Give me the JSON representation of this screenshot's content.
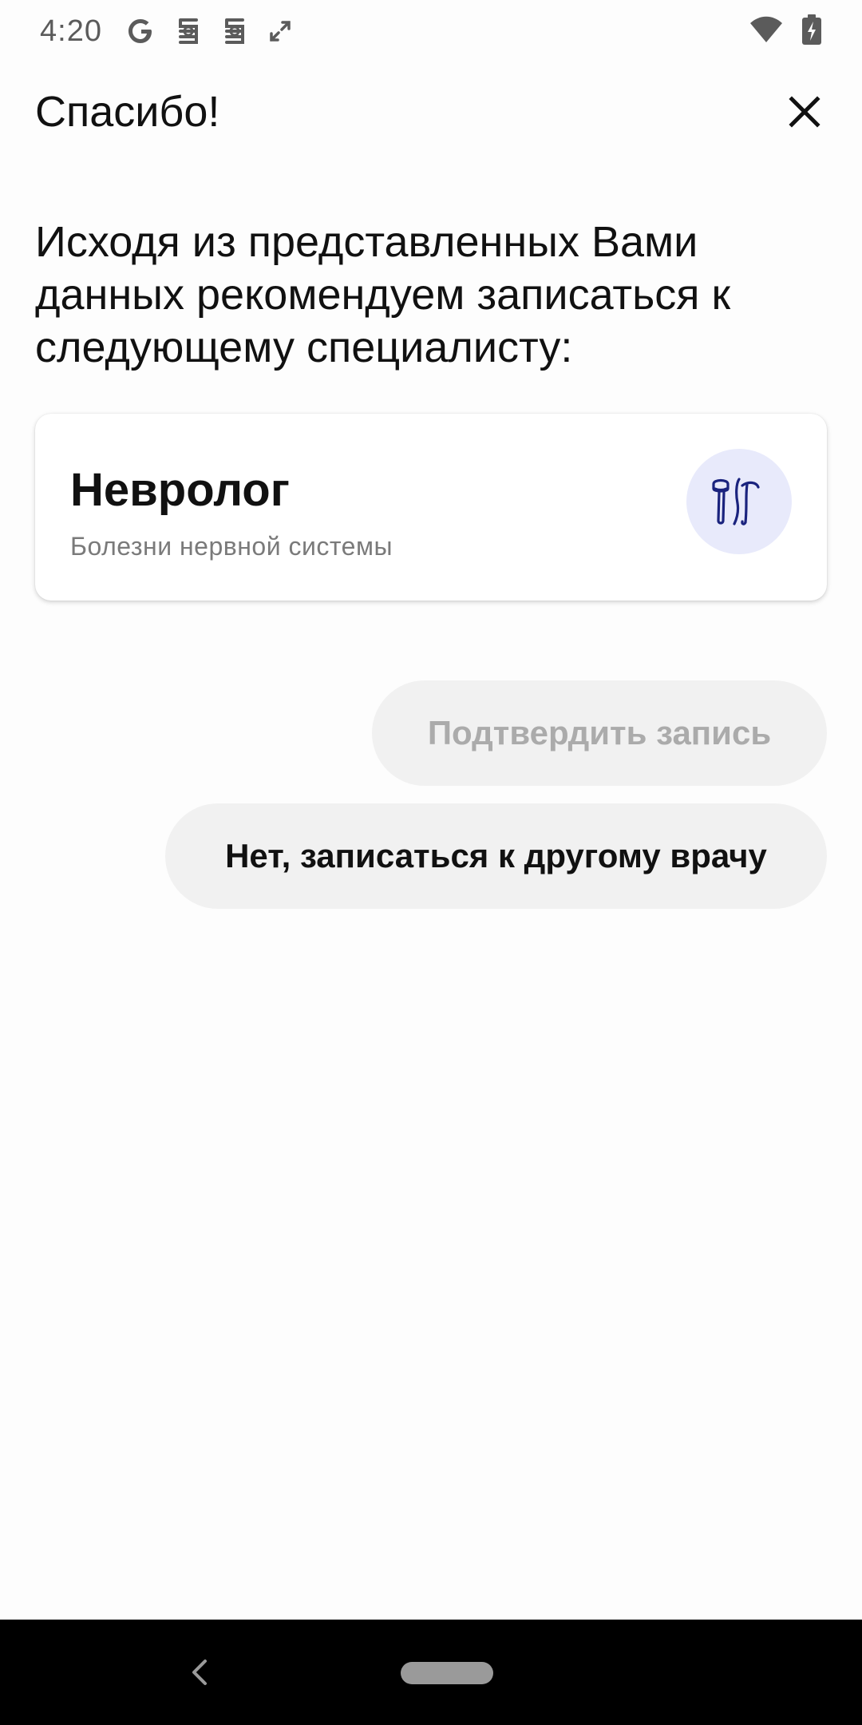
{
  "status_bar": {
    "time": "4:20",
    "left_icons": [
      "google-icon",
      "notification-icon",
      "notification-icon",
      "expand-arrows-icon"
    ],
    "right_icons": [
      "wifi-icon",
      "battery-charging-icon"
    ]
  },
  "header": {
    "title": "Спасибо!",
    "close_icon": "close-icon"
  },
  "recommendation": {
    "text": "Исходя из представленных Вами данных рекомендуем записаться к следующему специалисту:"
  },
  "specialist": {
    "name": "Невролог",
    "description": "Болезни нервной системы",
    "icon": "reflex-hammer-icon",
    "icon_bg_color": "#E8EAFB",
    "icon_color": "#1A237E"
  },
  "actions": {
    "confirm_label": "Подтвердить запись",
    "other_doctor_label": "Нет, записаться к другому врачу"
  },
  "nav_bar": {
    "back_icon": "back-chevron-icon",
    "home_icon": "home-pill-icon"
  }
}
